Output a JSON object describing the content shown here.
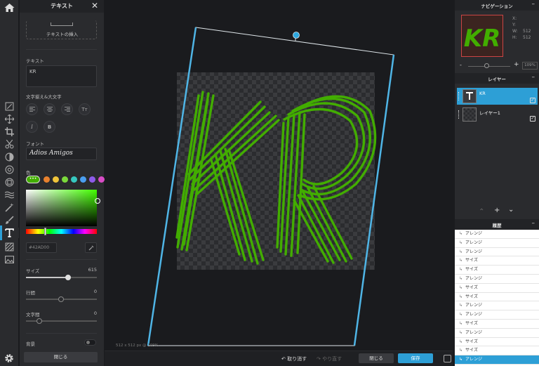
{
  "text_panel": {
    "title": "テキスト",
    "insert_label": "テキストの挿入",
    "text_label": "テキスト",
    "text_value": "KR",
    "align_label": "文字揃え&大文字",
    "font_label": "フォント",
    "font_value": "Adios Amigos",
    "color_label": "色",
    "swatch_more": "•••",
    "swatches": [
      "#e8812e",
      "#f0c43a",
      "#7bd93b",
      "#36c9c0",
      "#4a9ef0",
      "#8e5bea",
      "#d94cc6"
    ],
    "hex_value": "#42AD00",
    "size_label": "サイズ",
    "size_value": "615",
    "line_spacing_label": "行間",
    "line_spacing_value": "0",
    "letter_spacing_label": "文字間",
    "letter_spacing_value": "0",
    "background_label": "背景",
    "close_label": "閉じる"
  },
  "canvas": {
    "status": "512 x 512 px @ 109%",
    "undo_label": "取り消す",
    "redo_label": "やり直す",
    "close_label": "閉じる",
    "save_label": "保存",
    "text_color": "#42ad00",
    "accent": "#2d9fd6"
  },
  "navigation": {
    "title": "ナビゲーション",
    "x_label": "X:",
    "y_label": "Y:",
    "w_label": "W:",
    "w_value": "512",
    "h_label": "H:",
    "h_value": "512",
    "zoom_minus": "-",
    "zoom_plus": "+",
    "zoom_value": "109%",
    "zoom_level": 0.44
  },
  "layers": {
    "title": "レイヤー",
    "items": [
      {
        "name": "KR",
        "selected": true
      },
      {
        "name": "レイヤー1",
        "selected": false
      }
    ]
  },
  "history": {
    "title": "履歴",
    "items": [
      "アレンジ",
      "アレンジ",
      "アレンジ",
      "サイズ",
      "サイズ",
      "アレンジ",
      "サイズ",
      "サイズ",
      "アレンジ",
      "アレンジ",
      "サイズ",
      "アレンジ",
      "サイズ",
      "サイズ",
      "アレンジ"
    ]
  }
}
